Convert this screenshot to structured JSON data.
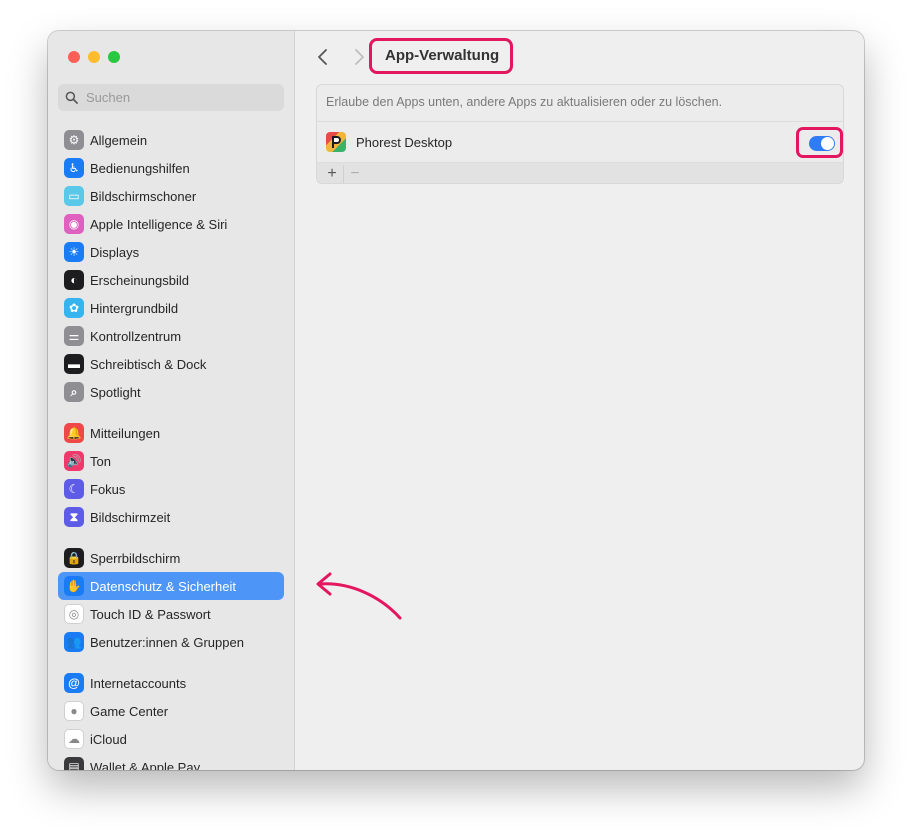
{
  "search": {
    "placeholder": "Suchen"
  },
  "sidebar": {
    "groups": [
      [
        {
          "label": "Allgemein",
          "icon": "gear-icon",
          "color": "#8e8e93"
        },
        {
          "label": "Bedienungshilfen",
          "icon": "accessibility-icon",
          "color": "#1a7cf4"
        },
        {
          "label": "Bildschirmschoner",
          "icon": "screensaver-icon",
          "color": "#5ac8e8"
        },
        {
          "label": "Apple Intelligence & Siri",
          "icon": "siri-icon",
          "color": "#e060c0"
        },
        {
          "label": "Displays",
          "icon": "sun-icon",
          "color": "#1a7cf4"
        },
        {
          "label": "Erscheinungsbild",
          "icon": "appearance-icon",
          "color": "#1d1d1f"
        },
        {
          "label": "Hintergrundbild",
          "icon": "flower-icon",
          "color": "#35b4f0"
        },
        {
          "label": "Kontrollzentrum",
          "icon": "switches-icon",
          "color": "#8e8e93"
        },
        {
          "label": "Schreibtisch & Dock",
          "icon": "dock-icon",
          "color": "#1d1d1f"
        },
        {
          "label": "Spotlight",
          "icon": "magnifier-icon",
          "color": "#8e8e93"
        }
      ],
      [
        {
          "label": "Mitteilungen",
          "icon": "bell-icon",
          "color": "#f04848"
        },
        {
          "label": "Ton",
          "icon": "speaker-icon",
          "color": "#f0386a"
        },
        {
          "label": "Fokus",
          "icon": "moon-icon",
          "color": "#5e5ce6"
        },
        {
          "label": "Bildschirmzeit",
          "icon": "hourglass-icon",
          "color": "#5e5ce6"
        }
      ],
      [
        {
          "label": "Sperrbildschirm",
          "icon": "lock-icon",
          "color": "#1d1d1f"
        },
        {
          "label": "Datenschutz & Sicherheit",
          "icon": "hand-icon",
          "color": "#1a7cf4",
          "active": true
        },
        {
          "label": "Touch ID & Passwort",
          "icon": "fingerprint-icon",
          "color": "#ffffff"
        },
        {
          "label": "Benutzer:innen & Gruppen",
          "icon": "users-icon",
          "color": "#1a7cf4"
        }
      ],
      [
        {
          "label": "Internetaccounts",
          "icon": "at-icon",
          "color": "#1a7cf4"
        },
        {
          "label": "Game Center",
          "icon": "game-center-icon",
          "color": "#ffffff"
        },
        {
          "label": "iCloud",
          "icon": "cloud-icon",
          "color": "#ffffff"
        },
        {
          "label": "Wallet & Apple Pay",
          "icon": "wallet-icon",
          "color": "#3a3a3c"
        }
      ]
    ]
  },
  "header": {
    "title": "App-Verwaltung"
  },
  "panel": {
    "description": "Erlaube den Apps unten, andere Apps zu aktualisieren oder zu löschen.",
    "apps": [
      {
        "name": "Phorest Desktop",
        "enabled": true
      }
    ],
    "add_label": "+",
    "remove_label": "−"
  },
  "colors": {
    "accent": "#2f7cf6",
    "highlight": "#e3165f",
    "selection": "#4d95f6"
  }
}
